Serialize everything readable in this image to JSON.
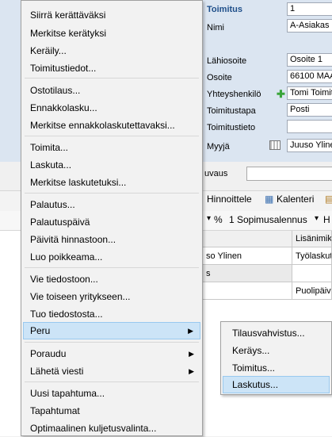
{
  "form": {
    "toimitus_label": "Toimitus",
    "toimitus_value": "1",
    "nimi_label": "Nimi",
    "nimi_value": "A-Asiakas O",
    "lahiosoite_label": "Lähiosoite",
    "lahiosoite_value": "Osoite 1",
    "osoite_label": "Osoite",
    "osoite_value": "66100  MAA",
    "yhteyshenkilo_label": "Yhteyshenkilö",
    "yhteyshenkilo_value": "Tomi Toimit",
    "toimitustapa_label": "Toimitustapa",
    "toimitustapa_value": "Posti",
    "toimitustieto_label": "Toimitustieto",
    "toimitustieto_value": "",
    "myyja_label": "Myyjä",
    "myyja_value": "Juuso Yline",
    "kuvaus_label": "uvaus"
  },
  "toolbar": {
    "hinnoittele": "Hinnoittele",
    "kalenteri": "Kalenteri",
    "percent": "%",
    "sopimusalennus": "1 Sopimusalennus",
    "h": "H"
  },
  "grid": {
    "col_header": "Lisänimik",
    "row1_a": "so Ylinen",
    "row1_b": "Työlaskut",
    "row2_a": "s",
    "row3_b": "Puolipäivä"
  },
  "menu": {
    "items": [
      {
        "label": "Siirrä kerättäväksi"
      },
      {
        "label": "Merkitse kerätyksi"
      },
      {
        "label": "Keräily..."
      },
      {
        "label": "Toimitustiedot..."
      },
      {
        "label": "Ostotilaus..."
      },
      {
        "label": "Ennakkolasku..."
      },
      {
        "label": "Merkitse ennakkolaskutettavaksi..."
      },
      {
        "label": "Toimita..."
      },
      {
        "label": "Laskuta..."
      },
      {
        "label": "Merkitse laskutetuksi..."
      },
      {
        "label": "Palautus..."
      },
      {
        "label": "Palautuspäivä"
      },
      {
        "label": "Päivitä hinnastoon..."
      },
      {
        "label": "Luo poikkeama..."
      },
      {
        "label": "Vie tiedostoon..."
      },
      {
        "label": "Vie toiseen yritykseen..."
      },
      {
        "label": "Tuo tiedostosta..."
      },
      {
        "label": "Peru"
      },
      {
        "label": "Poraudu"
      },
      {
        "label": "Lähetä viesti"
      },
      {
        "label": "Uusi tapahtuma..."
      },
      {
        "label": "Tapahtumat"
      },
      {
        "label": "Optimaalinen kuljetusvalinta..."
      }
    ]
  },
  "submenu": {
    "items": [
      {
        "label": "Tilausvahvistus..."
      },
      {
        "label": "Keräys..."
      },
      {
        "label": "Toimitus..."
      },
      {
        "label": "Laskutus..."
      }
    ]
  }
}
